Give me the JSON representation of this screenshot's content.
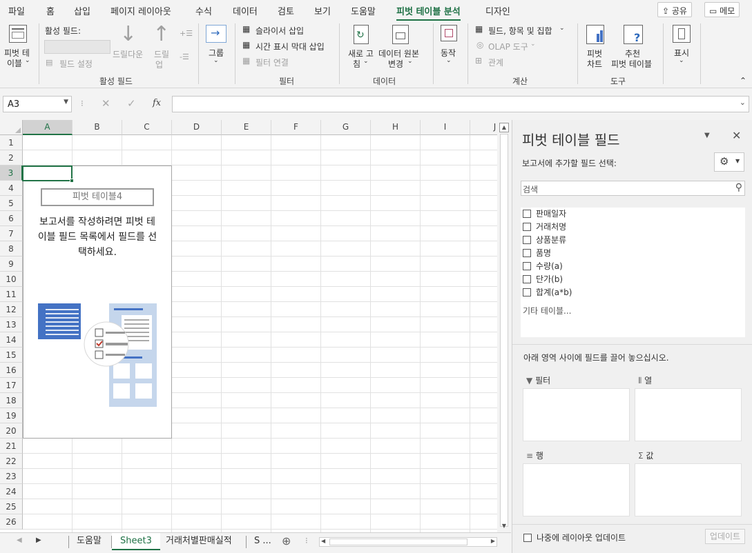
{
  "menu": {
    "tabs": [
      "파일",
      "홈",
      "삽입",
      "페이지 레이아웃",
      "수식",
      "데이터",
      "검토",
      "보기",
      "도움말",
      "피벗 테이블 분석",
      "디자인"
    ],
    "active_tab": "피벗 테이블 분석",
    "share_label": "공유",
    "memo_label": "메모"
  },
  "ribbon": {
    "pivot_line1": "피벗 테",
    "pivot_line2": "이블",
    "active_field_label": "활성 필드:",
    "field_settings": "필드 설정",
    "drilldown": "드릴다운",
    "drillup_1": "드릴",
    "drillup_2": "업",
    "group_active_field": "활성 필드",
    "group_btn": "그룹",
    "slicer": "슬라이서 삽입",
    "timeline": "시간 표시 막대 삽입",
    "filter_conn": "필터 연결",
    "group_filter": "필터",
    "refresh_1": "새로 고",
    "refresh_2": "침",
    "change_src_1": "데이터 원본",
    "change_src_2": "변경",
    "data_top": "데이터",
    "group_data": "데이터",
    "actions": "동작",
    "fields_items": "필드, 항목 및 집합",
    "olap": "OLAP 도구",
    "relations": "관계",
    "group_calc": "계산",
    "pivotchart_1": "피벗",
    "pivotchart_2": "차트",
    "recommended_1": "추천",
    "recommended_2": "피벗 테이블",
    "group_tools": "도구",
    "show": "표시"
  },
  "formula_bar": {
    "name_box": "A3",
    "fx": "fx",
    "value": ""
  },
  "grid": {
    "columns": [
      "A",
      "B",
      "C",
      "D",
      "E",
      "F",
      "G",
      "H",
      "I",
      "J"
    ],
    "rows": [
      "1",
      "2",
      "3",
      "4",
      "5",
      "6",
      "7",
      "8",
      "9",
      "10",
      "11",
      "12",
      "13",
      "14",
      "15",
      "16",
      "17",
      "18",
      "19",
      "20",
      "21",
      "22",
      "23",
      "24",
      "25",
      "26"
    ]
  },
  "pivot_placeholder": {
    "name": "피벗 테이블4",
    "line1": "보고서를 작성하려면 피벗 테",
    "line2": "이블 필드 목록에서 필드를 선",
    "line3": "택하세요."
  },
  "sheets": {
    "tabs": [
      "도움말",
      "Sheet3",
      "거래처별판매실적",
      "S ..."
    ],
    "active": "Sheet3",
    "add": "⊕"
  },
  "panel": {
    "title": "피벗 테이블 필드",
    "subtitle": "보고서에 추가할 필드 선택:",
    "search_placeholder": "검색",
    "fields": [
      "판매일자",
      "거래처명",
      "상품분류",
      "품명",
      "수량(a)",
      "단가(b)",
      "합계(a*b)"
    ],
    "more_tables": "기타 테이블...",
    "drag_hint": "아래 영역 사이에 필드를 끌어 놓으십시오.",
    "zone_filter": "필터",
    "zone_columns": "열",
    "zone_rows": "행",
    "zone_values": "값",
    "defer_label": "나중에 레이아웃 업데이트",
    "update_btn": "업데이트"
  },
  "colors": {
    "accent": "#1e7145",
    "selection": "#217346",
    "icon_blue": "#4472c4"
  }
}
